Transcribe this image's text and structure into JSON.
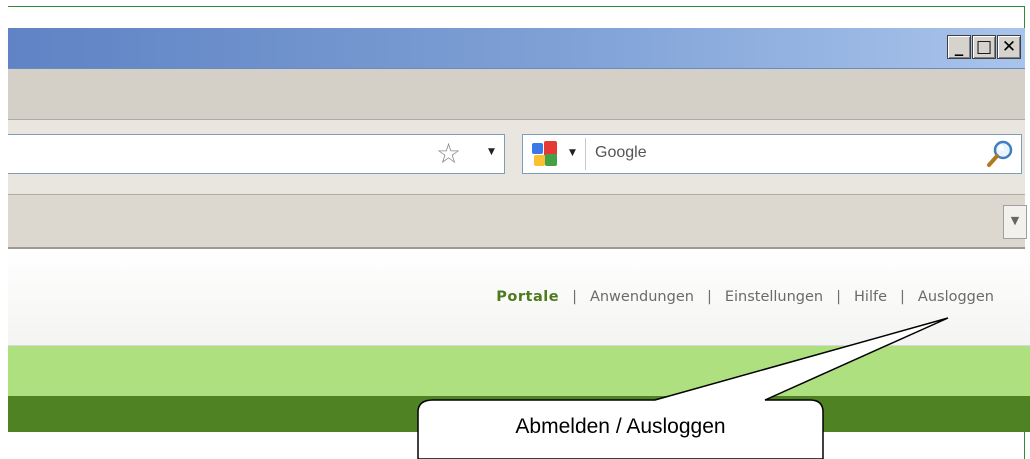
{
  "window": {
    "minimize_label": "_",
    "maximize_label": "□",
    "close_label": "✕"
  },
  "navbar": {
    "bookmark_icon": "star-icon",
    "search": {
      "engine_icon": "google-icon",
      "placeholder": "Google",
      "search_icon": "magnifier-icon"
    }
  },
  "tabbar": {
    "dropdown_icon": "tab-list-dropdown-icon"
  },
  "page": {
    "nav": [
      {
        "label": "Portale",
        "active": true
      },
      {
        "label": "Anwendungen"
      },
      {
        "label": "Einstellungen"
      },
      {
        "label": "Hilfe"
      },
      {
        "label": "Ausloggen"
      }
    ],
    "separator": "|",
    "colors": {
      "active_nav": "#4e7a1e",
      "light_band": "#aee080",
      "dark_band": "#4e8222"
    }
  },
  "callout": {
    "text": "Abmelden / Ausloggen"
  }
}
